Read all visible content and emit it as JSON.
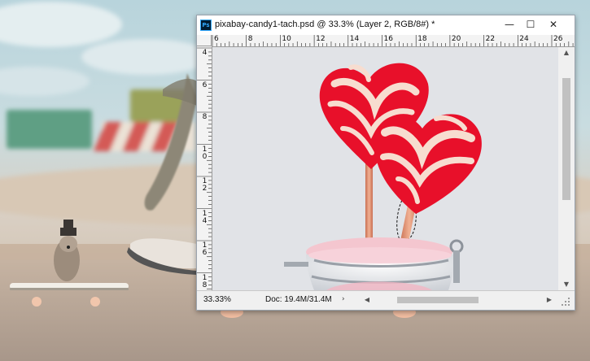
{
  "document": {
    "title": "pixabay-candy1-tach.psd @ 33.3% (Layer 2, RGB/8#) *",
    "app_icon": "photoshop-icon",
    "app_icon_text": "Ps"
  },
  "window_controls": {
    "minimize": "—",
    "maximize": "☐",
    "close": "✕"
  },
  "rulers": {
    "horizontal": [
      "6",
      "8",
      "10",
      "12",
      "14",
      "16",
      "18",
      "20",
      "22",
      "24",
      "26"
    ],
    "vertical": [
      "4",
      "6",
      "8",
      "10",
      "12",
      "14",
      "16",
      "18"
    ]
  },
  "status_bar": {
    "zoom": "33.33%",
    "doc_info": "Doc: 19.4M/31.4M",
    "arrow": "›"
  },
  "scroll": {
    "up": "▲",
    "down": "▼",
    "left": "◀",
    "right": "▶"
  },
  "colors": {
    "canvas_bg": "#e1e3e7",
    "candy_red": "#e8102a",
    "candy_cream": "#f7ddd0",
    "stick": "#e39a7a"
  }
}
